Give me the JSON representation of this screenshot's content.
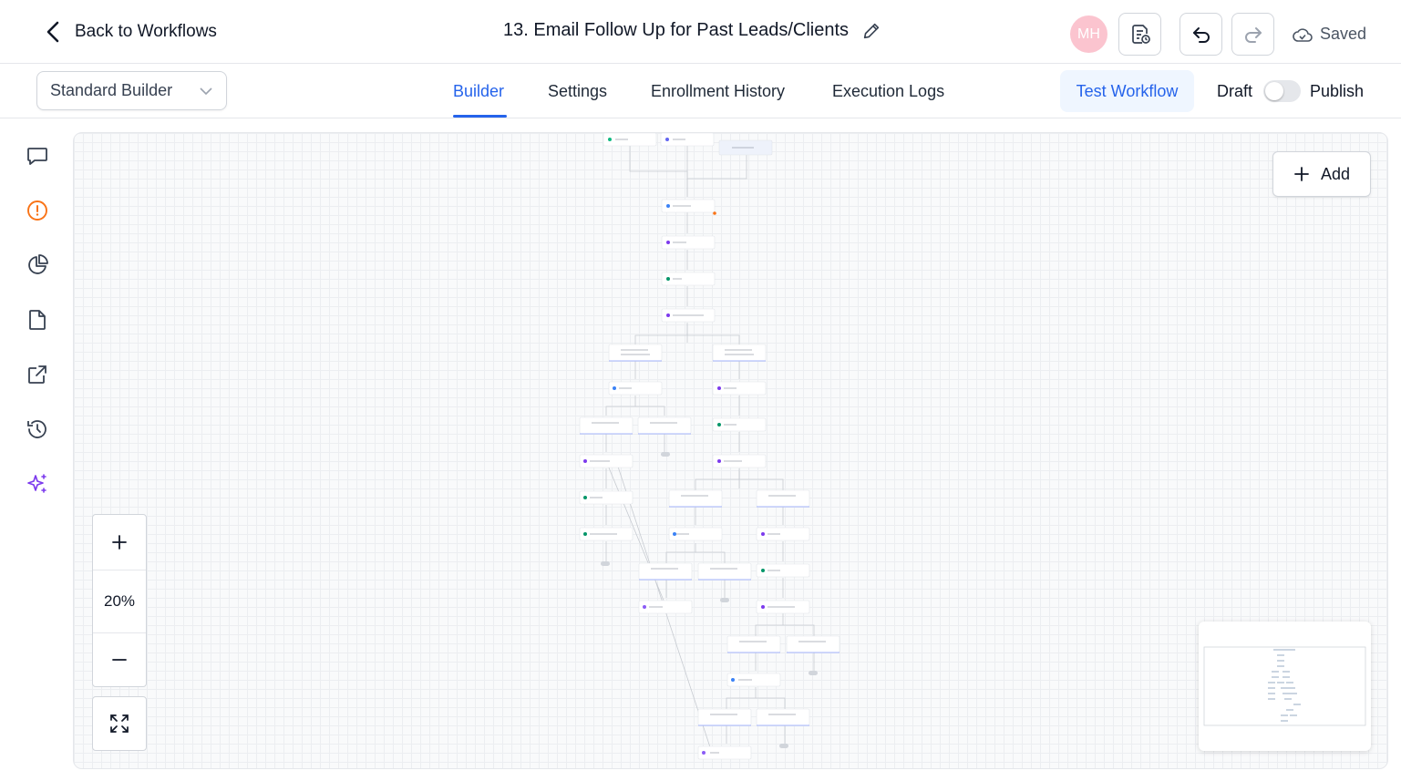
{
  "header": {
    "back_label": "Back to Workflows",
    "workflow_title": "13. Email Follow Up for Past Leads/Clients",
    "avatar_initials": "MH",
    "saved_label": "Saved"
  },
  "subbar": {
    "builder_select": "Standard Builder",
    "tabs": [
      {
        "label": "Builder",
        "active": true
      },
      {
        "label": "Settings",
        "active": false
      },
      {
        "label": "Enrollment History",
        "active": false
      },
      {
        "label": "Execution Logs",
        "active": false
      }
    ],
    "test_label": "Test Workflow",
    "draft_label": "Draft",
    "publish_label": "Publish",
    "published": false
  },
  "canvas": {
    "add_label": "Add",
    "zoom_level": "20%"
  },
  "colors": {
    "accent": "#2563eb",
    "avatar": "#fbc4cf",
    "alert": "#f97316",
    "ai": "#7c3aed"
  },
  "icons": {
    "rail": [
      "chat-icon",
      "alert-icon",
      "pie-chart-icon",
      "file-icon",
      "external-link-icon",
      "history-icon",
      "sparkle-icon"
    ]
  }
}
